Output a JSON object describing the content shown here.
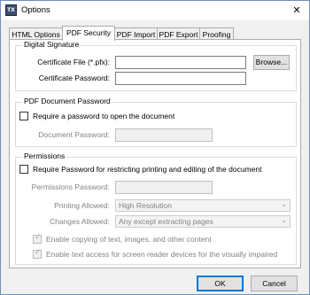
{
  "window": {
    "title": "Options",
    "app_icon_text": "TX",
    "close_symbol": "✕"
  },
  "tabs": [
    {
      "label": "HTML Options"
    },
    {
      "label": "PDF Security"
    },
    {
      "label": "PDF Import"
    },
    {
      "label": "PDF Export"
    },
    {
      "label": "Proofing"
    }
  ],
  "active_tab": "PDF Security",
  "digital_signature": {
    "legend": "Digital Signature",
    "certificate_file_label": "Certificate File (*.pfx):",
    "certificate_file_value": "",
    "browse_label": "Browse...",
    "certificate_password_label": "Certificate Password:",
    "certificate_password_value": ""
  },
  "pdf_document_password": {
    "legend": "PDF Document Password",
    "require_checkbox_label": "Require a password to open the document",
    "require_checked": false,
    "document_password_label": "Document Password:",
    "document_password_value": ""
  },
  "permissions": {
    "legend": "Permissions",
    "require_checkbox_label": "Require Password for restricting printing and editing of the document",
    "require_checked": false,
    "permissions_password_label": "Permissions Password:",
    "permissions_password_value": "",
    "printing_allowed_label": "Printing Allowed:",
    "printing_allowed_value": "High Resolution",
    "changes_allowed_label": "Changes Allowed:",
    "changes_allowed_value": "Any except extracting pages",
    "enable_copying_label": "Enable copying of text, images, and other content",
    "enable_copying_checked": true,
    "enable_text_access_label": "Enable text access for screen reader devices for the visually impaired",
    "enable_text_access_checked": true
  },
  "buttons": {
    "ok_label": "OK",
    "cancel_label": "Cancel"
  },
  "icons": {
    "checkmark": "✓",
    "dropdown_arrow": "⌄"
  },
  "colors": {
    "accent": "#0078d7",
    "window_bg": "#f0f0f0",
    "panel_bg": "#ffffff",
    "disabled_text": "#838383"
  }
}
